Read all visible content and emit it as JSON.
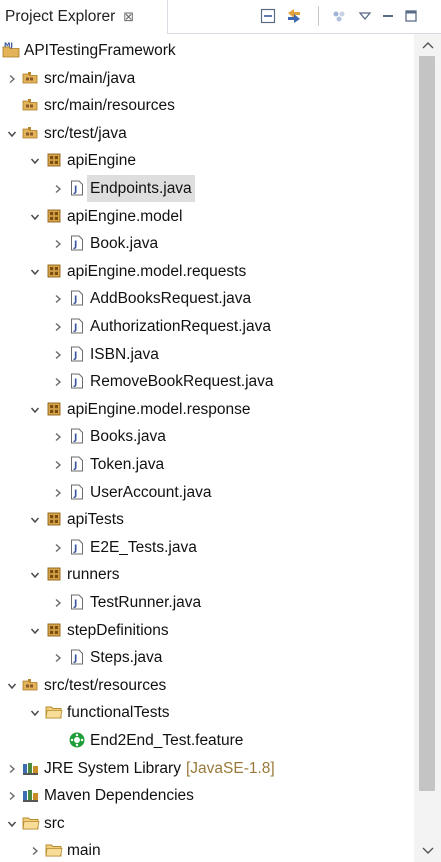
{
  "view": {
    "title": "Project Explorer",
    "close_glyph": "⊠"
  },
  "toolbar": {
    "icons": [
      "collapse-all-icon",
      "link-with-editor-icon",
      "filters-icon",
      "view-menu-icon",
      "minimize-icon",
      "maximize-icon"
    ]
  },
  "tree": [
    {
      "label": "APITestingFramework",
      "icon": "project-icon",
      "expander": "none",
      "depth": 0
    },
    {
      "label": "src/main/java",
      "icon": "source-folder-icon",
      "expander": "collapsed",
      "depth": 0
    },
    {
      "label": "src/main/resources",
      "icon": "source-folder-icon",
      "expander": "none",
      "depth": 0
    },
    {
      "label": "src/test/java",
      "icon": "source-folder-icon",
      "expander": "expanded",
      "depth": 0
    },
    {
      "label": "apiEngine",
      "icon": "package-icon",
      "expander": "expanded",
      "depth": 1
    },
    {
      "label": "Endpoints.java",
      "icon": "java-file-icon",
      "expander": "collapsed",
      "depth": 2,
      "selected": true
    },
    {
      "label": "apiEngine.model",
      "icon": "package-icon",
      "expander": "expanded",
      "depth": 1
    },
    {
      "label": "Book.java",
      "icon": "java-file-icon",
      "expander": "collapsed",
      "depth": 2
    },
    {
      "label": "apiEngine.model.requests",
      "icon": "package-icon",
      "expander": "expanded",
      "depth": 1
    },
    {
      "label": "AddBooksRequest.java",
      "icon": "java-file-icon",
      "expander": "collapsed",
      "depth": 2
    },
    {
      "label": "AuthorizationRequest.java",
      "icon": "java-file-icon",
      "expander": "collapsed",
      "depth": 2
    },
    {
      "label": "ISBN.java",
      "icon": "java-file-icon",
      "expander": "collapsed",
      "depth": 2
    },
    {
      "label": "RemoveBookRequest.java",
      "icon": "java-file-icon",
      "expander": "collapsed",
      "depth": 2
    },
    {
      "label": "apiEngine.model.response",
      "icon": "package-icon",
      "expander": "expanded",
      "depth": 1
    },
    {
      "label": "Books.java",
      "icon": "java-file-icon",
      "expander": "collapsed",
      "depth": 2
    },
    {
      "label": "Token.java",
      "icon": "java-file-icon",
      "expander": "collapsed",
      "depth": 2
    },
    {
      "label": "UserAccount.java",
      "icon": "java-file-icon",
      "expander": "collapsed",
      "depth": 2
    },
    {
      "label": "apiTests",
      "icon": "package-icon",
      "expander": "expanded",
      "depth": 1
    },
    {
      "label": "E2E_Tests.java",
      "icon": "java-file-icon",
      "expander": "collapsed",
      "depth": 2
    },
    {
      "label": "runners",
      "icon": "package-icon",
      "expander": "expanded",
      "depth": 1
    },
    {
      "label": "TestRunner.java",
      "icon": "java-file-icon",
      "expander": "collapsed",
      "depth": 2
    },
    {
      "label": "stepDefinitions",
      "icon": "package-icon",
      "expander": "expanded",
      "depth": 1
    },
    {
      "label": "Steps.java",
      "icon": "java-file-icon",
      "expander": "collapsed",
      "depth": 2
    },
    {
      "label": "src/test/resources",
      "icon": "source-folder-icon",
      "expander": "expanded",
      "depth": 0
    },
    {
      "label": "functionalTests",
      "icon": "folder-icon",
      "expander": "expanded",
      "depth": 1
    },
    {
      "label": "End2End_Test.feature",
      "icon": "cucumber-feature-icon",
      "expander": "none",
      "depth": 2
    },
    {
      "label": "JRE System Library",
      "decoration": "[JavaSE-1.8]",
      "icon": "library-icon",
      "expander": "collapsed",
      "depth": 0
    },
    {
      "label": "Maven Dependencies",
      "icon": "library-icon",
      "expander": "collapsed",
      "depth": 0
    },
    {
      "label": "src",
      "icon": "folder-icon",
      "expander": "expanded",
      "depth": 0
    },
    {
      "label": "main",
      "icon": "folder-icon",
      "expander": "collapsed",
      "depth": 1
    }
  ],
  "scrollbar": {
    "up": "scroll-up",
    "down": "scroll-down"
  }
}
